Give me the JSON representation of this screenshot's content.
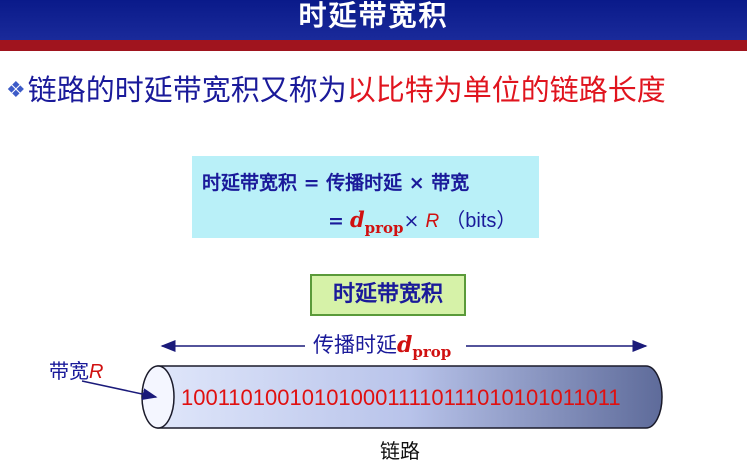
{
  "title": "时延带宽积",
  "subtitle": {
    "bullet": "❖",
    "part1": "链路的时延带宽积又称为",
    "part2": "以比特为单位的链路长度"
  },
  "formula": {
    "line1": "时延带宽积 = 传播时延 × 带宽",
    "eq": "=",
    "d": "d",
    "sub": "prop",
    "times": "×",
    "r": "R",
    "bits": "（bits）"
  },
  "bdp_label": "时延带宽积",
  "propagation": {
    "label": "传播时延",
    "d": "d",
    "sub": "prop"
  },
  "bandwidth": {
    "label": "带宽",
    "r": "R"
  },
  "bit_stream": "1001101001010100011110111010101011011",
  "link_label": "链路",
  "colors": {
    "title_bar": "#0a1a8a",
    "title_rule": "#a0141e",
    "formula_bg": "#b9f0f8",
    "bdp_bg": "#d6f2a8",
    "text_blue": "#1a1a9a",
    "text_red": "#e0141e"
  }
}
